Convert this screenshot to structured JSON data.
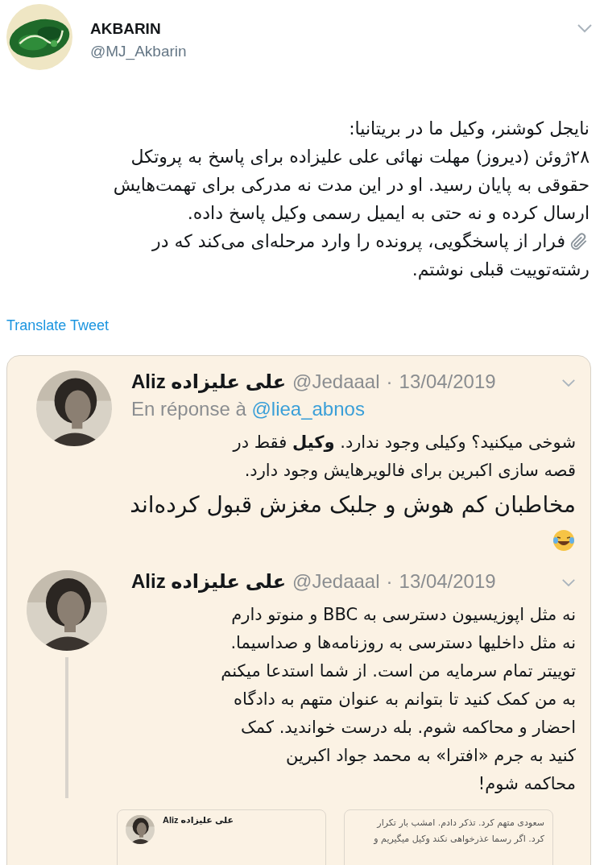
{
  "tweet": {
    "author": {
      "name": "AKBARIN",
      "handle": "@MJ_Akbarin"
    },
    "lines": [
      {
        "kind": "text",
        "text": "نایجل کوشنر، وکیل ما در بریتانیا:"
      },
      {
        "kind": "text",
        "text": "۲۸ژوئن (دیروز) مهلت نهائی علی علیزاده برای پاسخ به پروتکل"
      },
      {
        "kind": "text",
        "text": "حقوقی به پایان رسید. او در این مدت نه مدرکی برای تهمت‌هایش"
      },
      {
        "kind": "text",
        "text": "ارسال کرده و نه حتی به ایمیل رسمی وکیل پاسخ داده."
      },
      {
        "kind": "attachment",
        "text": "فرار از پاسخگویی، پرونده را وارد مرحله‌ای می‌کند که در"
      },
      {
        "kind": "text",
        "text": "رشته‌توییت قبلی نوشتم."
      }
    ],
    "translate": "Translate Tweet"
  },
  "quoted_thread": {
    "tweets": [
      {
        "name": "علی علیزاده Aliz",
        "handle": "@Jedaaal",
        "separator": "·",
        "date": "13/04/2019",
        "reply_to": {
          "prefix": "En réponse à",
          "handle": "@liea_abnos"
        },
        "thread_line": false,
        "lines": [
          {
            "kind": "text",
            "text": "شوخی میکنید؟ وکیلی وجود ندارد. **وکیل** فقط در"
          },
          {
            "kind": "text",
            "text": "قصه سازی اکبرین برای فالویرهایش وجود دارد."
          },
          {
            "kind": "large",
            "text": "مخاطبان کم هوش و جلبک مغزش قبول کرده‌اند"
          },
          {
            "kind": "emoji"
          }
        ]
      },
      {
        "name": "علی علیزاده Aliz",
        "handle": "@Jedaaal",
        "separator": "·",
        "date": "13/04/2019",
        "thread_line": true,
        "lines": [
          {
            "kind": "text",
            "text": "نه مثل اپوزیسیون دسترسی به BBC و منوتو دارم"
          },
          {
            "kind": "text",
            "text": "نه مثل داخلیها دسترسی به روزنامه‌ها و صداسیما."
          },
          {
            "kind": "text",
            "text": "توییتر تمام سرمایه من است. از شما استدعا میکنم"
          },
          {
            "kind": "text",
            "text": "به من کمک کنید تا بتوانم به عنوان متهم به دادگاه"
          },
          {
            "kind": "text",
            "text": "احضار و محاکمه شوم. بله درست خواندید. کمک"
          },
          {
            "kind": "text",
            "text": "کنید به جرم «افترا» به محمد جواد اکبرین"
          },
          {
            "kind": "text",
            "text": "محاکمه شوم!"
          }
        ]
      }
    ],
    "embedded_cards": [
      {
        "kind": "text",
        "lines": [
          "سعودی متهم کرد. تذکر دادم. امشب بار تکرار",
          "کرد. اگر رسما عذرخواهی نکند وکیل میگیریم و"
        ]
      },
      {
        "kind": "profile",
        "name": "علی علیزاده Aliz"
      }
    ]
  }
}
